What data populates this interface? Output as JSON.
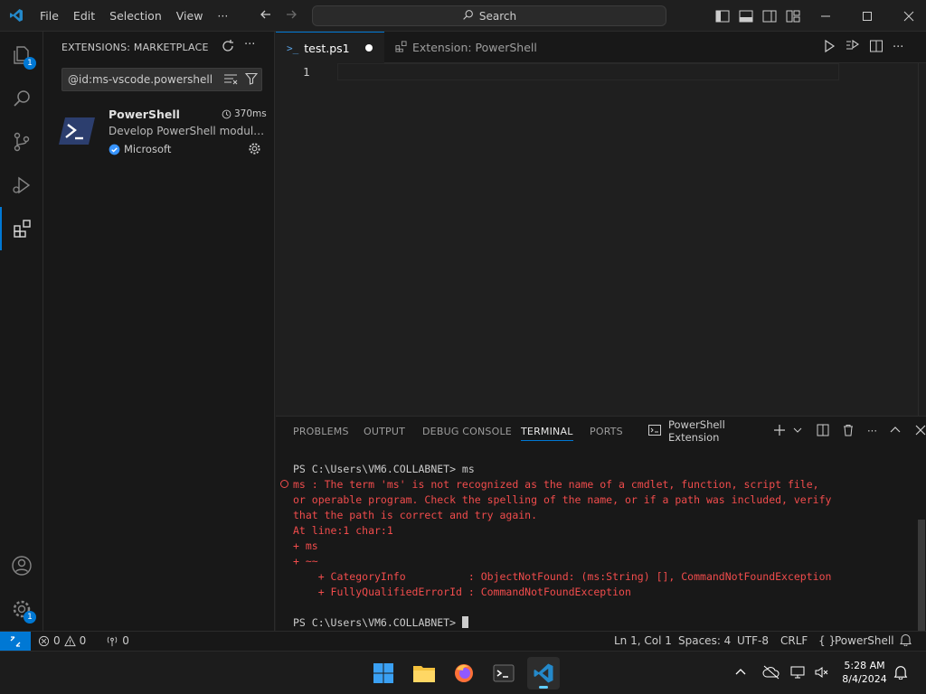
{
  "menu": [
    "File",
    "Edit",
    "Selection",
    "View",
    "···"
  ],
  "command_center": {
    "label": "Search"
  },
  "activity_badges": {
    "explorer": "1",
    "manage": "1"
  },
  "sidebar": {
    "title": "EXTENSIONS: MARKETPLACE",
    "search_value": "@id:ms-vscode.powershell",
    "extension": {
      "name": "PowerShell",
      "time": "370ms",
      "description": "Develop PowerShell modules, commands and scripts in Visual Studio Code!",
      "publisher": "Microsoft"
    }
  },
  "tabs": [
    {
      "label": "test.ps1",
      "modified": true
    },
    {
      "label": "Extension: PowerShell"
    }
  ],
  "editor": {
    "line_number": "1"
  },
  "panel": {
    "tabs": [
      "PROBLEMS",
      "OUTPUT",
      "DEBUG CONSOLE",
      "TERMINAL",
      "PORTS"
    ],
    "active_tab": "TERMINAL",
    "terminal_name": "PowerShell Extension",
    "lines": [
      {
        "text": "PS C:\\Users\\VM6.COLLABNET> ms",
        "kind": "ok"
      },
      {
        "text": "ms : The term 'ms' is not recognized as the name of a cmdlet, function, script file,",
        "kind": "err"
      },
      {
        "text": "or operable program. Check the spelling of the name, or if a path was included, verify",
        "kind": "err"
      },
      {
        "text": "that the path is correct and try again.",
        "kind": "err"
      },
      {
        "text": "At line:1 char:1",
        "kind": "err"
      },
      {
        "text": "+ ms",
        "kind": "err"
      },
      {
        "text": "+ ~~",
        "kind": "err"
      },
      {
        "text": "    + CategoryInfo          : ObjectNotFound: (ms:String) [], CommandNotFoundException",
        "kind": "err"
      },
      {
        "text": "    + FullyQualifiedErrorId : CommandNotFoundException",
        "kind": "err"
      },
      {
        "text": "",
        "kind": "ok"
      },
      {
        "text": "PS C:\\Users\\VM6.COLLABNET> ",
        "kind": "ok"
      }
    ]
  },
  "statusbar": {
    "errors": "0",
    "warnings": "0",
    "ports": "0",
    "position": "Ln 1, Col 1",
    "spaces": "Spaces: 4",
    "encoding": "UTF-8",
    "eol": "CRLF",
    "language": "PowerShell"
  },
  "taskbar": {
    "time": "5:28 AM",
    "date": "8/4/2024"
  },
  "colors": {
    "accent": "#0078d4",
    "error": "#f14c4c",
    "background": "#1f1f1f"
  }
}
